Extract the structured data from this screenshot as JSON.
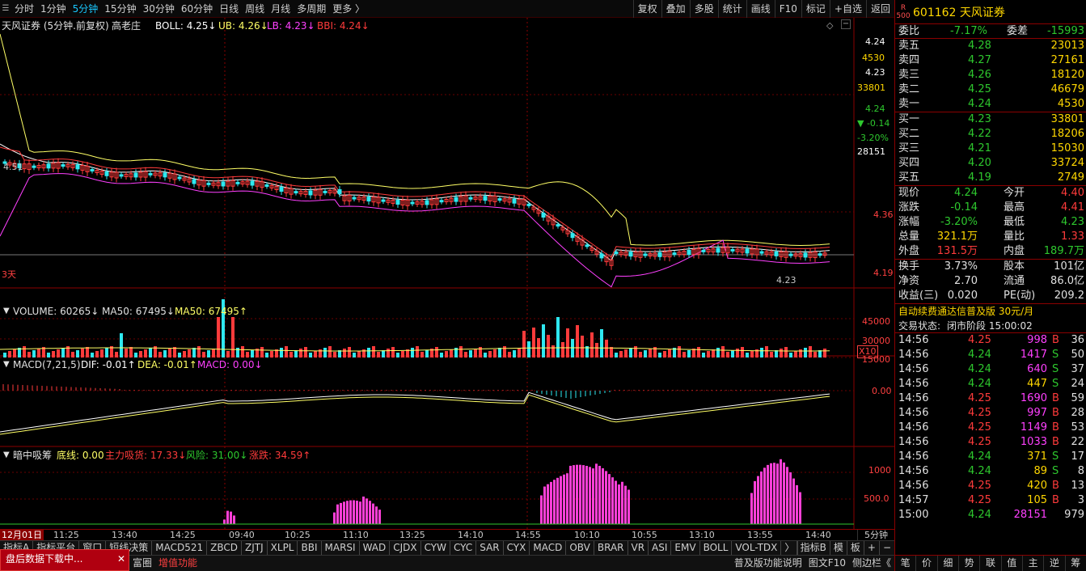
{
  "topbar": {
    "timeframes": [
      {
        "label": "分时",
        "active": false
      },
      {
        "label": "1分钟",
        "active": false
      },
      {
        "label": "5分钟",
        "active": true
      },
      {
        "label": "15分钟",
        "active": false
      },
      {
        "label": "30分钟",
        "active": false
      },
      {
        "label": "60分钟",
        "active": false
      },
      {
        "label": "日线",
        "active": false
      },
      {
        "label": "周线",
        "active": false
      },
      {
        "label": "月线",
        "active": false
      },
      {
        "label": "多周期",
        "active": false
      },
      {
        "label": "更多 〉",
        "active": false
      }
    ],
    "tools": [
      "复权",
      "叠加",
      "多股",
      "统计",
      "画线",
      "F10",
      "标记",
      "+自选",
      "返回"
    ]
  },
  "main_panel": {
    "legend_name": "天风证券 (5分钟.前复权)",
    "legend_mode": "高老庄",
    "boll": "BOLL: 4.25↓",
    "ub": "UB: 4.26↓",
    "lb": "LB: 4.23↓",
    "bbi": "BBI: 4.24↓",
    "left_price_label": "4.51",
    "low_price_label": "4.23",
    "days_label": "3天",
    "axis": {
      "price_top": "4.24",
      "vol_top": "4530",
      "price_2": "4.23",
      "vol_2": "33801",
      "price_3": "4.24",
      "change": "▼ -0.14",
      "change_pct": "-3.20%",
      "vol_3": "28151",
      "level_mid": "4.36",
      "level_low": "4.19"
    }
  },
  "volume_panel": {
    "vol": "VOLUME: 60265↓",
    "ma50a": "MA50: 67495↓",
    "ma50b": "MA50: 67495↑",
    "axis": [
      "45000",
      "30000",
      "15000"
    ],
    "scale": "X10"
  },
  "macd_panel": {
    "name": "MACD(7,21,5)",
    "dif": "DIF: -0.01↑",
    "dea": "DEA: -0.01↑",
    "macd": "MACD: 0.00↓",
    "axis": "0.00"
  },
  "ahzx_panel": {
    "name": "暗中吸筹",
    "base": "底线: 0.00",
    "main": "主力吸货: 17.33↓",
    "risk": "风险: 31.00↓",
    "rise": "涨跌: 34.59↑",
    "axis": [
      "1000",
      "500.0"
    ]
  },
  "timeaxis": {
    "labels": [
      "12月01日",
      "11:25",
      "13:40",
      "14:25",
      "09:40",
      "10:25",
      "11:10",
      "13:25",
      "14:10",
      "14:55",
      "10:10",
      "10:55",
      "13:10",
      "13:55",
      "14:40"
    ],
    "period": "5分钟"
  },
  "indicator_tabs": [
    "指标A",
    "指标平台",
    "窗口",
    "短线决策",
    "MACD521",
    "ZBCD",
    "ZJTJ",
    "XLPL",
    "BBI",
    "MARSI",
    "WAD",
    "CJDX",
    "CYW",
    "CYC",
    "SAR",
    "CYX",
    "MACD",
    "OBV",
    "BRAR",
    "VR",
    "ASI",
    "EMV",
    "BOLL",
    "VOL-TDX",
    "〉"
  ],
  "indicator_right": [
    "指标B",
    "模",
    "板",
    "+",
    "−"
  ],
  "bottombar": {
    "items": [
      "富圈",
      "增值功能"
    ],
    "right": [
      "普及版功能说明",
      "图文F10",
      "侧边栏《"
    ]
  },
  "popup": {
    "text": "盘后数据下载中...",
    "close": "✕"
  },
  "quote": {
    "badge": "R 500",
    "code_name": "601162 天风证券",
    "weibi_label": "委比",
    "weibi": "-7.17%",
    "weicha_label": "委差",
    "weicha": "-15993",
    "asks": [
      {
        "label": "卖五",
        "price": "4.28",
        "vol": "23013"
      },
      {
        "label": "卖四",
        "price": "4.27",
        "vol": "27161"
      },
      {
        "label": "卖三",
        "price": "4.26",
        "vol": "18120"
      },
      {
        "label": "卖二",
        "price": "4.25",
        "vol": "46679"
      },
      {
        "label": "卖一",
        "price": "4.24",
        "vol": "4530"
      }
    ],
    "bids": [
      {
        "label": "买一",
        "price": "4.23",
        "vol": "33801"
      },
      {
        "label": "买二",
        "price": "4.22",
        "vol": "18206"
      },
      {
        "label": "买三",
        "price": "4.21",
        "vol": "15030"
      },
      {
        "label": "买四",
        "price": "4.20",
        "vol": "33724"
      },
      {
        "label": "买五",
        "price": "4.19",
        "vol": "2749"
      }
    ],
    "stats": [
      {
        "l1": "现价",
        "v1": "4.24",
        "c1": "c-green",
        "l2": "今开",
        "v2": "4.40",
        "c2": "c-red"
      },
      {
        "l1": "涨跌",
        "v1": "-0.14",
        "c1": "c-green",
        "l2": "最高",
        "v2": "4.41",
        "c2": "c-red"
      },
      {
        "l1": "涨幅",
        "v1": "-3.20%",
        "c1": "c-green",
        "l2": "最低",
        "v2": "4.23",
        "c2": "c-green"
      },
      {
        "l1": "总量",
        "v1": "321.1万",
        "c1": "c-yellow",
        "l2": "量比",
        "v2": "1.33",
        "c2": "c-red"
      },
      {
        "l1": "外盘",
        "v1": "131.5万",
        "c1": "c-red",
        "l2": "内盘",
        "v2": "189.7万",
        "c2": "c-green"
      }
    ],
    "stats2": [
      {
        "l1": "换手",
        "v1": "3.73%",
        "l2": "股本",
        "v2": "101亿"
      },
      {
        "l1": "净资",
        "v1": "2.70",
        "l2": "流通",
        "v2": "86.0亿"
      },
      {
        "l1": "收益(三)",
        "v1": "0.020",
        "l2": "PE(动)",
        "v2": "209.2"
      }
    ],
    "ad": "自动续费通达信普及版  30元/月",
    "status_label": "交易状态:",
    "status": "闭市阶段 15:00:02"
  },
  "trades": [
    {
      "t": "14:56",
      "p": "4.25",
      "pc": "c-red",
      "v": "998",
      "vc": "c-purple",
      "d": "B",
      "n": "36"
    },
    {
      "t": "14:56",
      "p": "4.24",
      "pc": "c-green",
      "v": "1417",
      "vc": "c-purple",
      "d": "S",
      "n": "50"
    },
    {
      "t": "14:56",
      "p": "4.24",
      "pc": "c-green",
      "v": "640",
      "vc": "c-purple",
      "d": "S",
      "n": "37"
    },
    {
      "t": "14:56",
      "p": "4.24",
      "pc": "c-green",
      "v": "447",
      "vc": "c-yellow",
      "d": "S",
      "n": "24"
    },
    {
      "t": "14:56",
      "p": "4.25",
      "pc": "c-red",
      "v": "1690",
      "vc": "c-purple",
      "d": "B",
      "n": "59"
    },
    {
      "t": "14:56",
      "p": "4.25",
      "pc": "c-red",
      "v": "997",
      "vc": "c-purple",
      "d": "B",
      "n": "28"
    },
    {
      "t": "14:56",
      "p": "4.25",
      "pc": "c-red",
      "v": "1149",
      "vc": "c-purple",
      "d": "B",
      "n": "53"
    },
    {
      "t": "14:56",
      "p": "4.25",
      "pc": "c-red",
      "v": "1033",
      "vc": "c-purple",
      "d": "B",
      "n": "22"
    },
    {
      "t": "14:56",
      "p": "4.24",
      "pc": "c-green",
      "v": "371",
      "vc": "c-yellow",
      "d": "S",
      "n": "17"
    },
    {
      "t": "14:56",
      "p": "4.24",
      "pc": "c-green",
      "v": "89",
      "vc": "c-yellow",
      "d": "S",
      "n": "8"
    },
    {
      "t": "14:56",
      "p": "4.25",
      "pc": "c-red",
      "v": "420",
      "vc": "c-yellow",
      "d": "B",
      "n": "13"
    },
    {
      "t": "14:57",
      "p": "4.25",
      "pc": "c-red",
      "v": "105",
      "vc": "c-yellow",
      "d": "B",
      "n": "3"
    },
    {
      "t": "15:00",
      "p": "4.24",
      "pc": "c-green",
      "v": "28151",
      "vc": "c-purple",
      "d": "",
      "n": "979"
    }
  ],
  "right_tabs": [
    "笔",
    "价",
    "细",
    "势",
    "联",
    "值",
    "主",
    "逆",
    "筹"
  ],
  "colors": {
    "up": "#ff3b3b",
    "down": "#2ee8f0",
    "boll_mid": "#ffffff",
    "boll_ub": "#ffff66",
    "boll_lb": "#ff40ff",
    "bbi": "#ff3b3b"
  }
}
